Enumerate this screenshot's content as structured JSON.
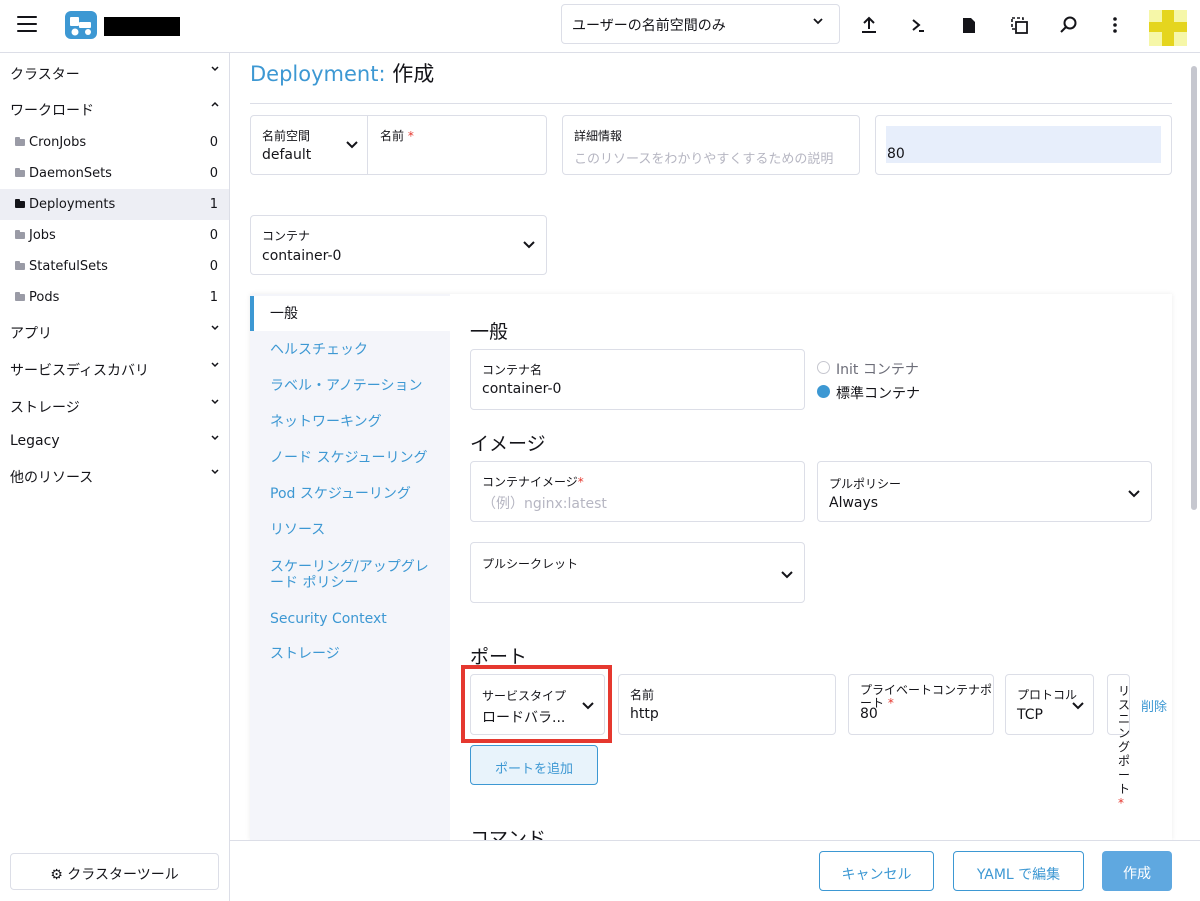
{
  "header": {
    "namespace_filter": "ユーザーの名前空間のみ",
    "icons": [
      "menu-icon",
      "upload-icon",
      "terminal-icon",
      "file-icon",
      "copy-icon",
      "search-icon",
      "more-vertical-icon"
    ]
  },
  "sidebar": {
    "groups": {
      "cluster": "クラスター",
      "workload": "ワークロード",
      "apps": "アプリ",
      "service_discovery": "サービスディスカバリ",
      "storage": "ストレージ",
      "legacy": "Legacy",
      "other": "他のリソース"
    },
    "workloads": [
      {
        "label": "CronJobs",
        "count": "0"
      },
      {
        "label": "DaemonSets",
        "count": "0"
      },
      {
        "label": "Deployments",
        "count": "1"
      },
      {
        "label": "Jobs",
        "count": "0"
      },
      {
        "label": "StatefulSets",
        "count": "0"
      },
      {
        "label": "Pods",
        "count": "1"
      }
    ],
    "cluster_tools": "クラスターツール"
  },
  "page": {
    "title_kind": "Deployment:",
    "title_action": "作成"
  },
  "form": {
    "namespace": {
      "label": "名前空間",
      "value": "default"
    },
    "name": {
      "label": "名前",
      "required": "*"
    },
    "description": {
      "label": "詳細情報",
      "placeholder": "このリソースをわかりやすくするための説明"
    },
    "replicas": {
      "value": "80"
    },
    "container_select": {
      "label": "コンテナ",
      "value": "container-0"
    }
  },
  "tabs": [
    "一般",
    "ヘルスチェック",
    "ラベル・アノテーション",
    "ネットワーキング",
    "ノード スケジューリング",
    "Pod スケジューリング",
    "リソース",
    "スケーリング/アップグレード ポリシー",
    "Security Context",
    "ストレージ"
  ],
  "general": {
    "heading": "一般",
    "container_name": {
      "label": "コンテナ名",
      "value": "container-0"
    },
    "radio_init": "Init コンテナ",
    "radio_standard": "標準コンテナ"
  },
  "image": {
    "heading": "イメージ",
    "container_image": {
      "label": "コンテナイメージ",
      "required": "*",
      "placeholder": "（例）nginx:latest"
    },
    "pull_policy": {
      "label": "プルポリシー",
      "value": "Always"
    },
    "pull_secret": {
      "label": "プルシークレット"
    }
  },
  "ports": {
    "heading": "ポート",
    "service_type": {
      "label": "サービスタイプ",
      "value": "ロードバラ..."
    },
    "name": {
      "label": "名前",
      "value": "http"
    },
    "private_port": {
      "label": "プライベートコンテナポート",
      "required": "*",
      "value": "80"
    },
    "protocol": {
      "label": "プロトコル",
      "value": "TCP"
    },
    "listening_port_label": "リスニングポート",
    "listening_required": "*",
    "delete": "削除",
    "add_port": "ポートを追加"
  },
  "command": {
    "heading": "コマンド"
  },
  "footer": {
    "cancel": "キャンセル",
    "edit_yaml": "YAML で編集",
    "create": "作成"
  }
}
